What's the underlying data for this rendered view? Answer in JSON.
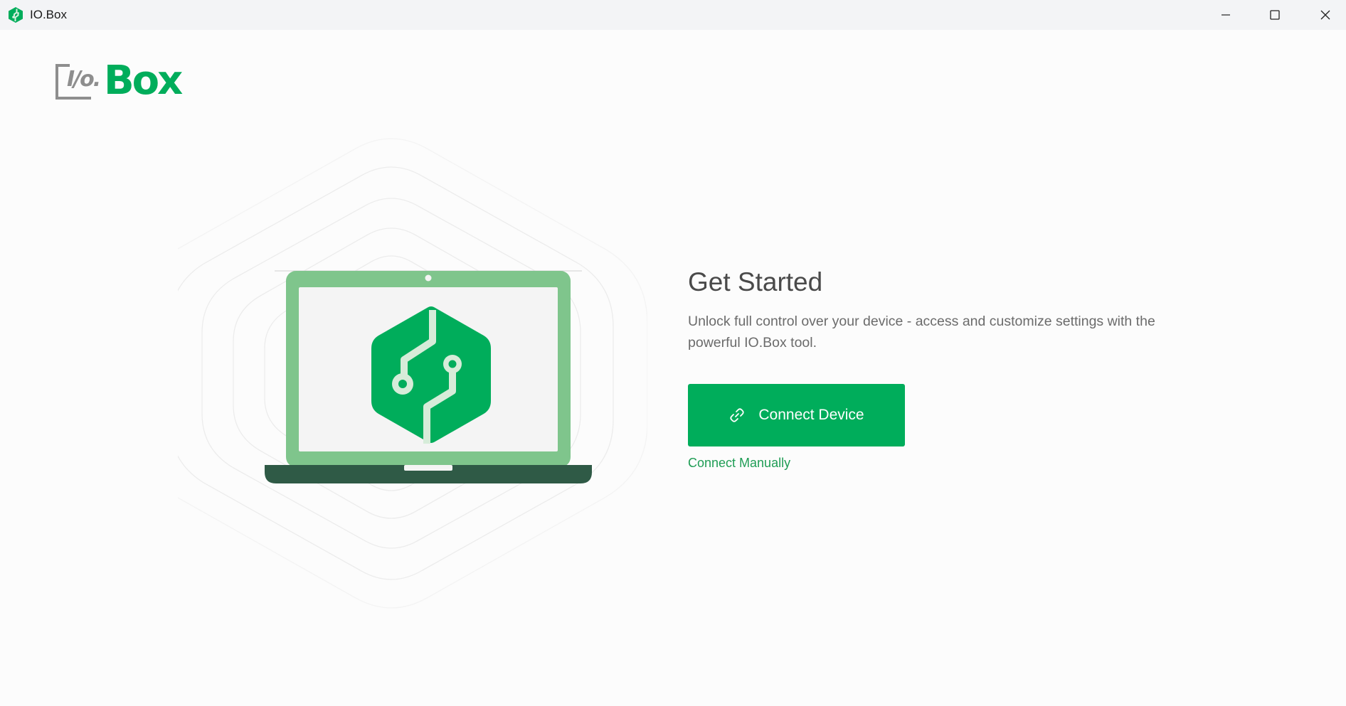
{
  "window": {
    "title": "IO.Box",
    "controls": {
      "minimize": "minimize-icon",
      "maximize": "maximize-icon",
      "close": "close-icon"
    }
  },
  "brand": {
    "io_text": "I/o.",
    "box_text": "Box"
  },
  "main": {
    "heading": "Get Started",
    "description": "Unlock full control over your device - access and customize settings with the powerful IO.Box tool.",
    "connect_button_label": "Connect Device",
    "connect_button_icon": "link-icon",
    "connect_manually_label": "Connect Manually"
  },
  "colors": {
    "accent": "#00ad5b",
    "laptop_frame": "#7fc58c",
    "laptop_base": "#2f5a46",
    "screen": "#f4f4f4",
    "link": "#1f9d55"
  }
}
